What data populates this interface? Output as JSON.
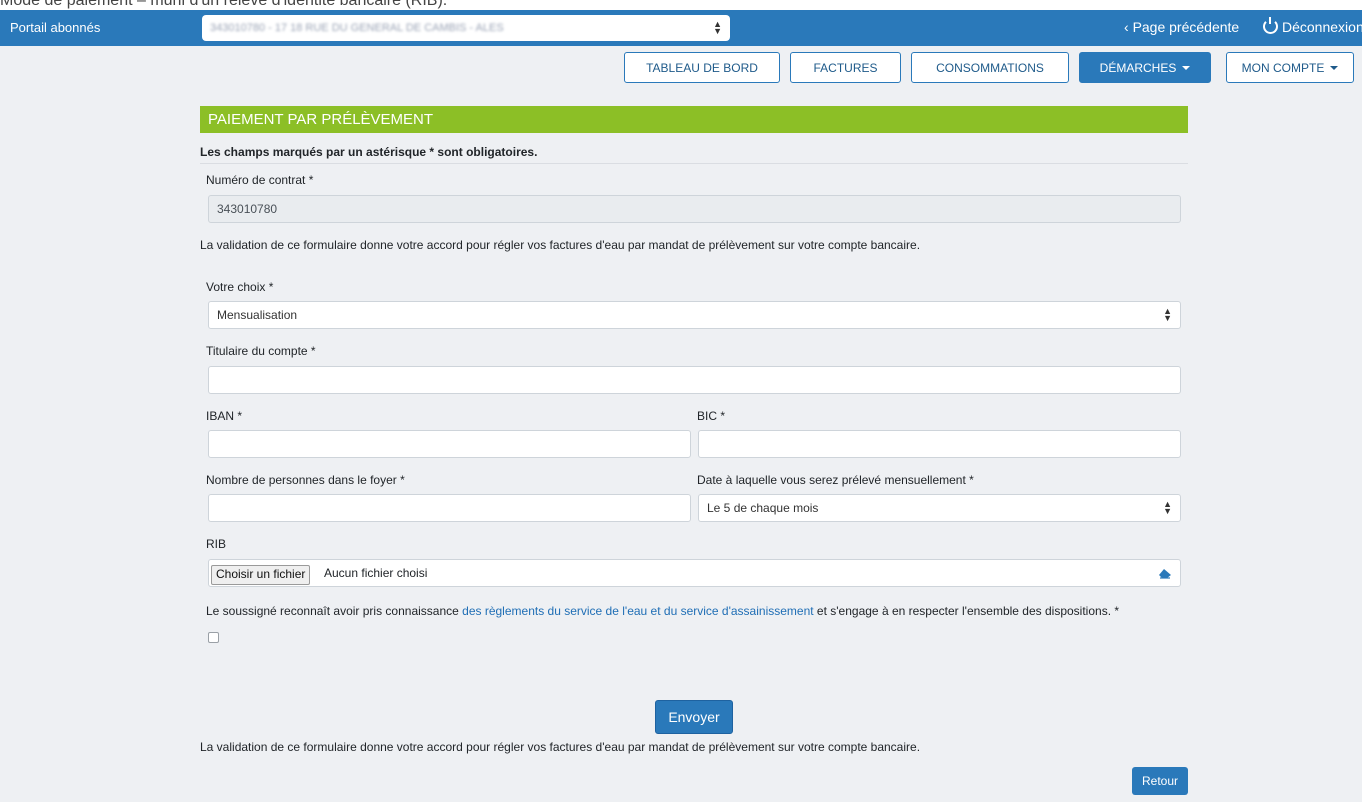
{
  "caption": "Mode de paiement – muni d'un relevé d'identité bancaire (RIB).",
  "topbar": {
    "brand": "Portail abonnés",
    "contract_select_value": "343010780 - 17 18 RUE DU GENERAL DE CAMBIS - ALES",
    "back_label": "Page précédente",
    "logout_label": "Déconnexion"
  },
  "nav": {
    "dashboard": "TABLEAU DE BORD",
    "invoices": "FACTURES",
    "consumption": "CONSOMMATIONS",
    "procedures": "DÉMARCHES",
    "account": "MON COMPTE"
  },
  "form": {
    "section_title": "PAIEMENT PAR PRÉLÈVEMENT",
    "required_note": "Les champs marqués par un astérisque * sont obligatoires.",
    "contract_label": "Numéro de contrat *",
    "contract_value": "343010780",
    "validation_text": "La validation de ce formulaire donne votre accord pour régler vos factures d'eau par mandat de prélèvement sur votre compte bancaire.",
    "choice_label": "Votre choix *",
    "choice_value": "Mensualisation",
    "holder_label": "Titulaire du compte *",
    "holder_value": "",
    "iban_label": "IBAN *",
    "iban_value": "",
    "bic_label": "BIC *",
    "bic_value": "",
    "household_label": "Nombre de personnes dans le foyer *",
    "household_value": "",
    "debit_date_label": "Date à laquelle vous serez prélevé mensuellement *",
    "debit_date_value": "Le 5 de chaque mois",
    "rib_label": "RIB",
    "file_button": "Choisir un fichier",
    "file_status": "Aucun fichier choisi",
    "terms_before": "Le soussigné reconnaît avoir pris connaissance ",
    "terms_link": "des règlements du service de l'eau et du service d'assainissement",
    "terms_after": " et s'engage à en respecter l'ensemble des dispositions. *",
    "submit_label": "Envoyer",
    "footer_text": "La validation de ce formulaire donne votre accord pour régler vos factures d'eau par mandat de prélèvement sur votre compte bancaire.",
    "back_label": "Retour"
  },
  "colors": {
    "primary": "#2a79ba",
    "section_green": "#8cbf26",
    "background": "#eef0f3"
  }
}
